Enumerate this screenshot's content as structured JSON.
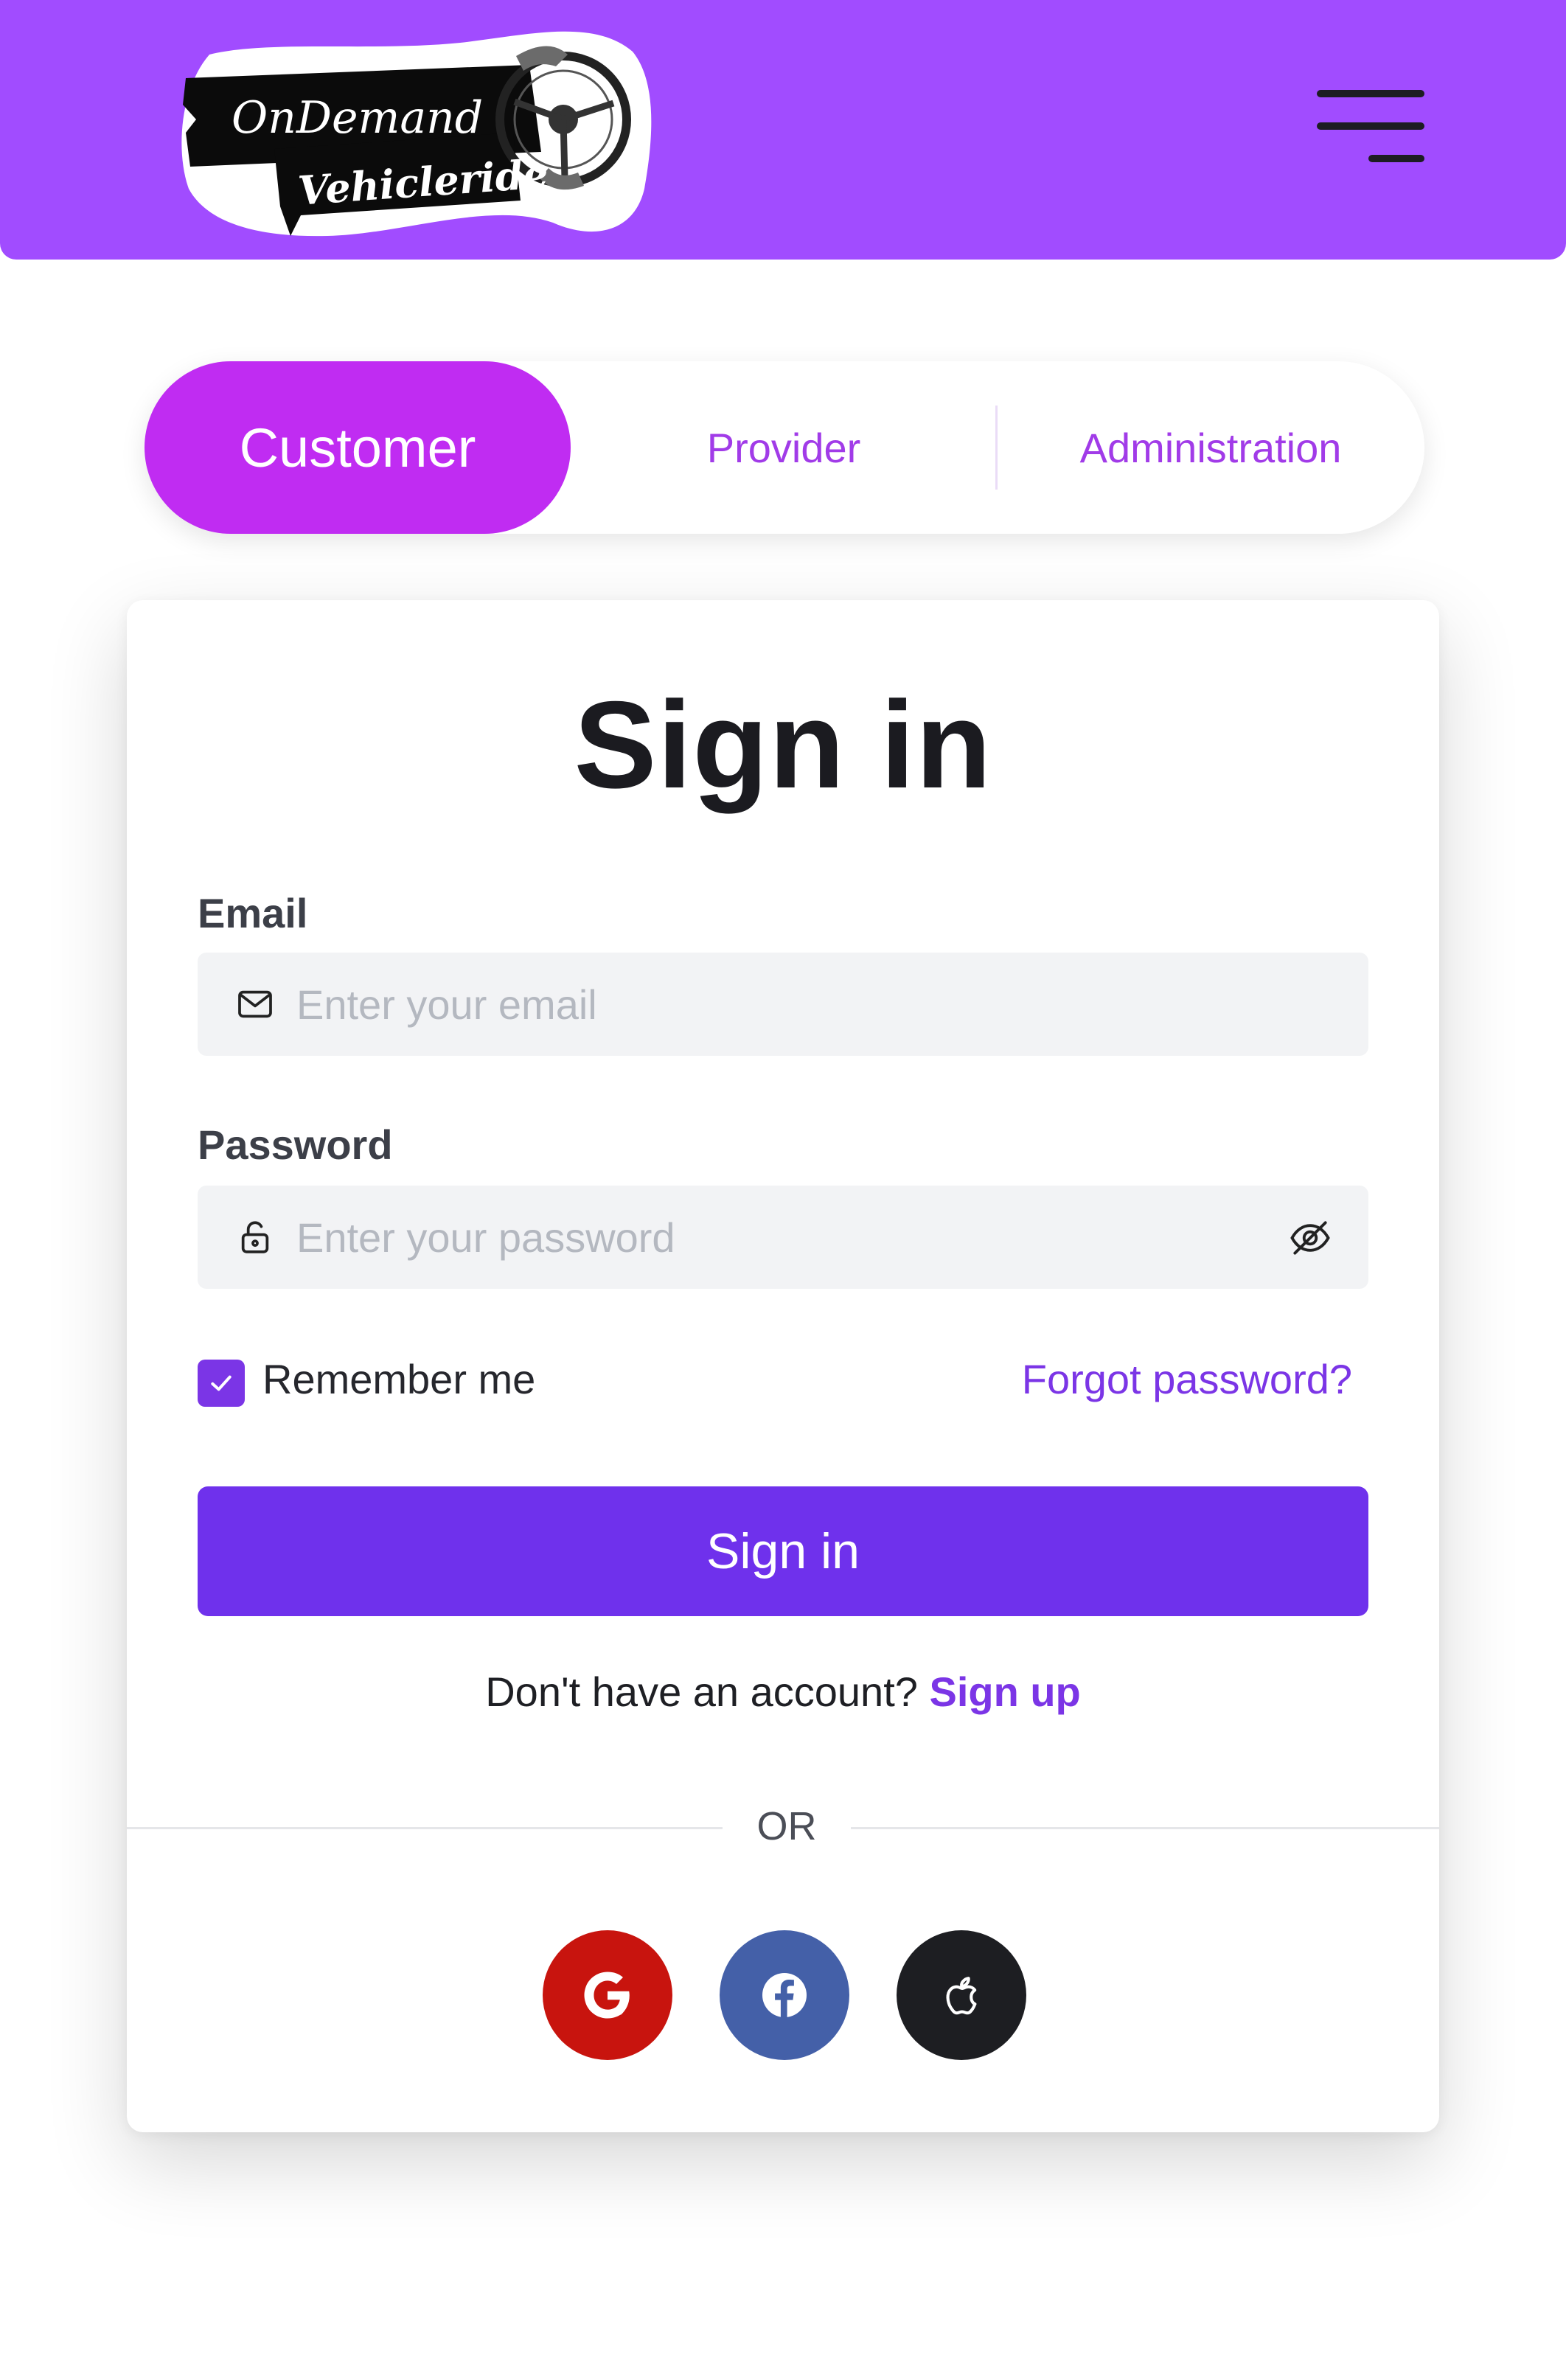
{
  "header": {
    "logo": {
      "line1": "OnDemand",
      "line2": "Vehicleride"
    },
    "menu_icon": "hamburger-menu-icon",
    "background": "#a14cff"
  },
  "role_tabs": [
    {
      "label": "Customer",
      "active": true
    },
    {
      "label": "Provider",
      "active": false
    },
    {
      "label": "Administration",
      "active": false
    }
  ],
  "form": {
    "title": "Sign in",
    "email": {
      "label": "Email",
      "placeholder": "Enter your email",
      "value": "",
      "icon": "mail-icon"
    },
    "password": {
      "label": "Password",
      "placeholder": "Enter your password",
      "value": "",
      "icon": "lock-icon",
      "toggle_icon": "eye-off-icon"
    },
    "remember_me": {
      "label": "Remember me",
      "checked": true
    },
    "forgot_password": "Forgot password?",
    "submit_label": "Sign in",
    "signup_prompt": "Don't have an account?",
    "signup_link": "Sign up",
    "divider_text": "OR"
  },
  "social_buttons": [
    {
      "provider": "Google",
      "icon": "google-icon",
      "color": "#c8140e"
    },
    {
      "provider": "Facebook",
      "icon": "facebook-icon",
      "color": "#4460a8"
    },
    {
      "provider": "Apple",
      "icon": "apple-icon",
      "color": "#1d1e22"
    }
  ],
  "colors": {
    "accent": "#6f31ec",
    "tab_active": "#c02cf2",
    "link": "#7b35e6"
  }
}
